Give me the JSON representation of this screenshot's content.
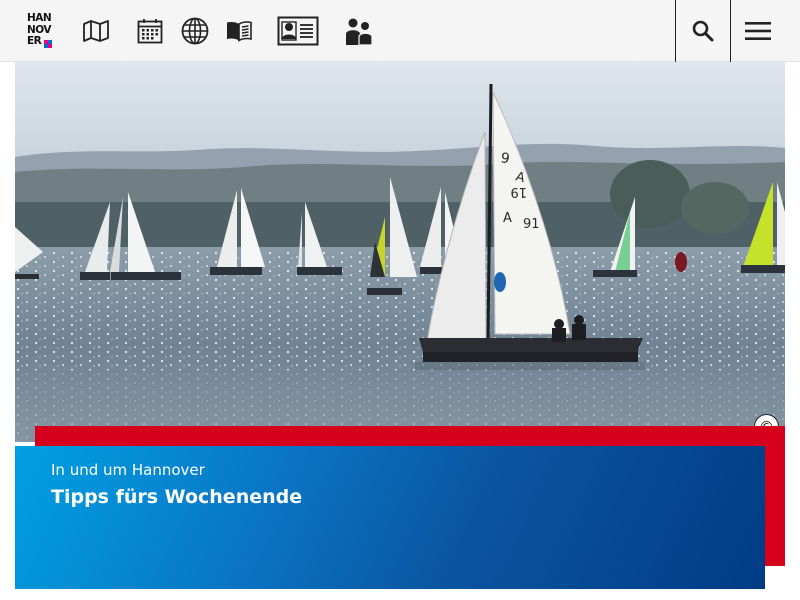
{
  "header": {
    "logo_lines": [
      "HAN",
      "NOV",
      "ER"
    ],
    "nav_icons": [
      "map-icon",
      "calendar-icon",
      "globe-icon",
      "book-icon",
      "id-card-icon",
      "people-icon"
    ],
    "search_icon": "search-icon",
    "menu_icon": "hamburger-menu-icon"
  },
  "hero": {
    "image_subject": "sailboats-on-lake",
    "copyright_symbol": "©"
  },
  "teaser": {
    "subtitle": "In und um Hannover",
    "title": "Tipps fürs Wochenende"
  },
  "colors": {
    "accent_red": "#d6001c",
    "blue_light": "#00a0e2",
    "blue_dark": "#003c85",
    "header_bg": "#f5f5f5",
    "logo_pink": "#e6007e",
    "logo_blue": "#0070c0"
  }
}
